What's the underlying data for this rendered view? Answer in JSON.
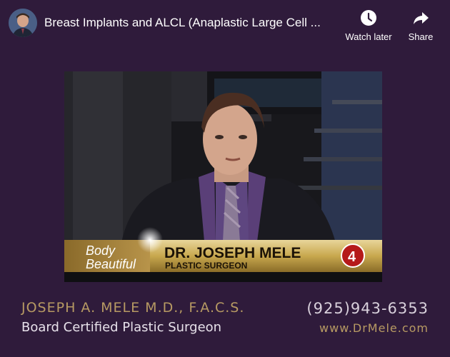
{
  "header": {
    "title": "Breast Implants and ALCL (Anaplastic Large Cell ...",
    "actions": [
      {
        "label": "Watch later",
        "icon": "clock-icon"
      },
      {
        "label": "Share",
        "icon": "share-arrow-icon"
      }
    ]
  },
  "video": {
    "show_logo_line1": "Body",
    "show_logo_line2": "Beautiful",
    "name": "DR. JOSEPH MELE",
    "role": "PLASTIC SURGEON",
    "channel_number": "4"
  },
  "footer": {
    "name_credentials": "JOSEPH A. MELE M.D., F.A.C.S.",
    "subtitle": "Board Certified Plastic Surgeon",
    "phone": "(925)943-6353",
    "website": "www.DrMele.com"
  },
  "colors": {
    "background": "#2f1b3b",
    "gold": "#b79a63",
    "lower_third_gold": "#c8a84e"
  }
}
